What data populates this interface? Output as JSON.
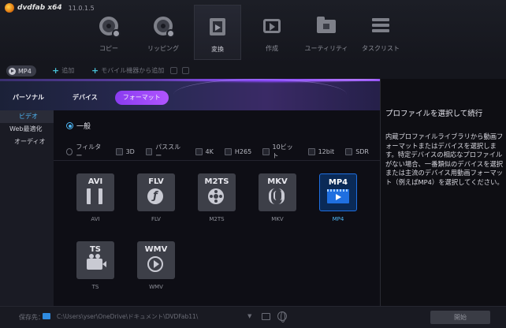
{
  "app": {
    "name": "dvdfab x64",
    "version": "11.0.1.5"
  },
  "nav": {
    "items": [
      {
        "label": "コピー"
      },
      {
        "label": "リッピング"
      },
      {
        "label": "変換"
      },
      {
        "label": "作成"
      },
      {
        "label": "ユーティリティ"
      },
      {
        "label": "タスクリスト"
      }
    ],
    "active_index": 2
  },
  "toolbar": {
    "format_badge": "MP4",
    "add_label": "追加",
    "add_mobile_label": "モバイル機器から追加"
  },
  "tabs": {
    "personal": "パーソナル",
    "device": "デバイス",
    "format": "フォーマット",
    "active": "format"
  },
  "side": {
    "items": [
      "ビデオ",
      "Web最適化",
      "オーディオ"
    ],
    "active_index": 0
  },
  "general": {
    "label": "一般"
  },
  "filters": {
    "label": "フィルター",
    "options": [
      "3D",
      "パススルー",
      "4K",
      "H265",
      "10ビット",
      "12bit",
      "SDR"
    ]
  },
  "formats": [
    {
      "title": "AVI",
      "caption": "AVI",
      "icon": "film-icon"
    },
    {
      "title": "FLV",
      "caption": "FLV",
      "icon": "flash-icon"
    },
    {
      "title": "M2TS",
      "caption": "M2TS",
      "icon": "reel-icon"
    },
    {
      "title": "MKV",
      "caption": "MKV",
      "icon": "mkv-icon"
    },
    {
      "title": "MP4",
      "caption": "MP4",
      "icon": "video-play-icon",
      "selected": true
    },
    {
      "title": "TS",
      "caption": "TS",
      "icon": "camera-icon"
    },
    {
      "title": "WMV",
      "caption": "WMV",
      "icon": "play-circle-icon"
    }
  ],
  "panel": {
    "title": "プロファイルを選択して続行",
    "description": "内蔵プロファイルライブラリから動画フォーマットまたはデバイスを選択します。特定デバイスの相応なプロファイルがない場合、一番類似のデバイスを選択または主流のデバイス用動画フォーマット（例えばMP4）を選択してください。"
  },
  "bottom": {
    "save_label": "保存先：",
    "path": "C:\\Users\\yser\\OneDrive\\ドキュメント\\DVDFab11\\",
    "start_label": "開始"
  },
  "colors": {
    "accent": "#4fb7f5",
    "tab_active": "#9b46f5",
    "selected_tile": "#1f6fe0"
  }
}
